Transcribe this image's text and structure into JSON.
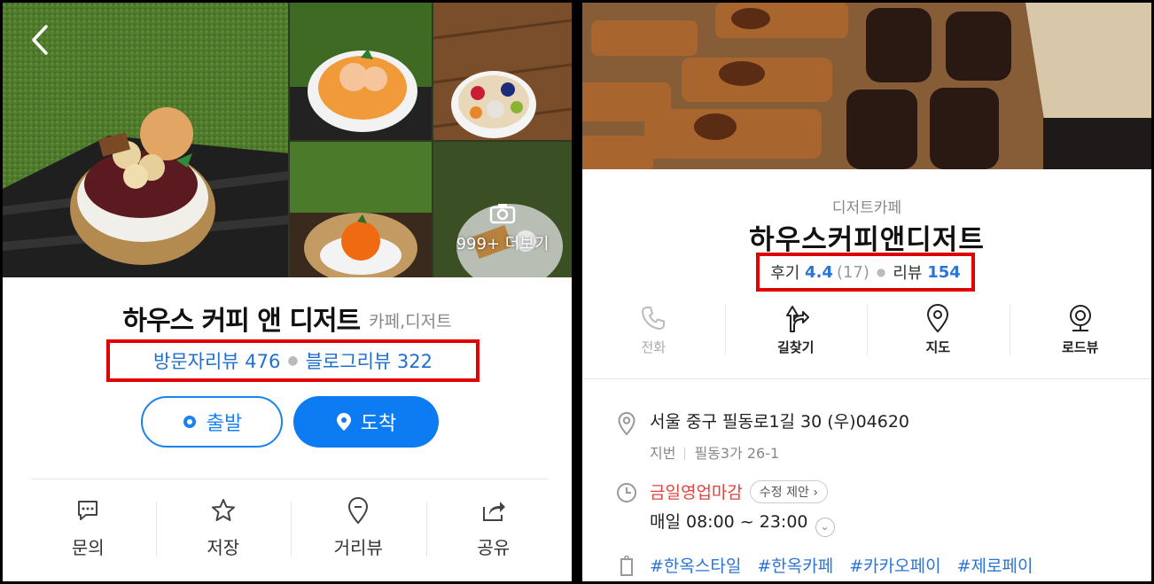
{
  "left": {
    "more_photos": "999+ 더보기",
    "title": "하우스 커피 앤 디저트",
    "category": "카페,디저트",
    "visitor_review": "방문자리뷰 476",
    "blog_review": "블로그리뷰 322",
    "depart_label": "출발",
    "arrive_label": "도착",
    "actions": [
      {
        "label": "문의",
        "icon": "chat-icon"
      },
      {
        "label": "저장",
        "icon": "star-icon"
      },
      {
        "label": "거리뷰",
        "icon": "map-pin-icon"
      },
      {
        "label": "공유",
        "icon": "share-icon"
      }
    ],
    "colors": {
      "brand": "#0d7cf2",
      "highlight": "#e00000"
    }
  },
  "right": {
    "category": "디저트카페",
    "title": "하우스커피앤디저트",
    "review_label": "후기",
    "rating": "4.4",
    "rating_count": "(17)",
    "review2_label": "리뷰",
    "review2_count": "154",
    "actions": [
      {
        "label": "전화",
        "icon": "phone-icon"
      },
      {
        "label": "길찾기",
        "icon": "directions-icon"
      },
      {
        "label": "지도",
        "icon": "map-pin-icon"
      },
      {
        "label": "로드뷰",
        "icon": "roadview-icon"
      }
    ],
    "address": "서울 중구 필동로1길 30 (우)04620",
    "lot_label": "지번",
    "lot_address": "필동3가 26-1",
    "closing_status": "금일영업마감",
    "edit_suggest": "수정 제안",
    "hours": "매일 08:00 ~ 23:00",
    "tags": [
      "#한옥스타일",
      "#한옥카페",
      "#카카오페이",
      "#제로페이"
    ]
  }
}
